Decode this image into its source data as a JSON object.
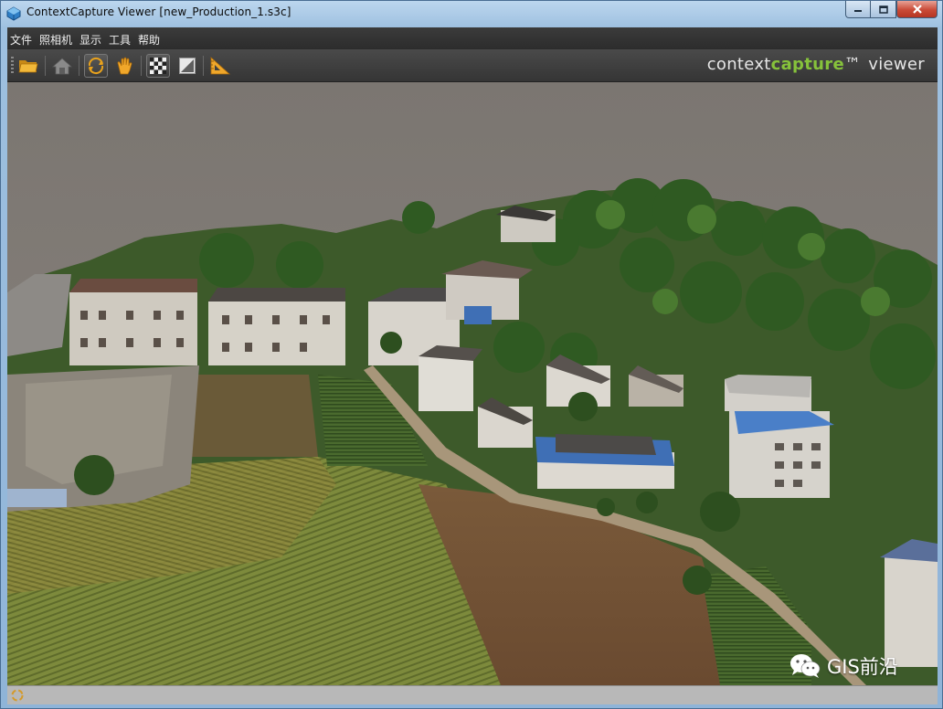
{
  "window": {
    "title": "ContextCapture Viewer [new_Production_1.s3c]"
  },
  "menu": {
    "items": [
      {
        "label": "文件"
      },
      {
        "label": "照相机"
      },
      {
        "label": "显示"
      },
      {
        "label": "工具"
      },
      {
        "label": "帮助"
      }
    ]
  },
  "toolbar": {
    "buttons": [
      {
        "name": "open-folder",
        "icon": "folder-icon",
        "active": false
      },
      {
        "name": "home-view",
        "icon": "home-icon",
        "active": false
      },
      {
        "name": "orbit",
        "icon": "orbit-icon",
        "active": true
      },
      {
        "name": "pan",
        "icon": "hand-icon",
        "active": false
      },
      {
        "name": "texture",
        "icon": "checkerboard-icon",
        "active": false
      },
      {
        "name": "shading",
        "icon": "square-shade-icon",
        "active": false
      },
      {
        "name": "measure",
        "icon": "ruler-triangle-icon",
        "active": false
      }
    ],
    "brand": {
      "part1": "context",
      "part2": "capture",
      "part3": "™",
      "part4": "viewer",
      "accent_color": "#86c23b"
    }
  },
  "viewport": {
    "content": "3D reality mesh"
  },
  "watermark": {
    "text": "GIS前沿",
    "icon": "wechat-icon"
  },
  "colors": {
    "menubar": "#2f2f2f",
    "toolbar": "#404040",
    "titlebar": "#a9c6e4",
    "close_button": "#c94a36"
  }
}
